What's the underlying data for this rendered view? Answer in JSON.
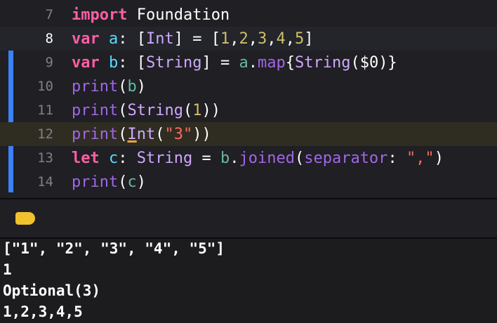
{
  "editor": {
    "lines": [
      {
        "num": "7"
      },
      {
        "num": "8"
      },
      {
        "num": "9"
      },
      {
        "num": "10"
      },
      {
        "num": "11"
      },
      {
        "num": "12"
      },
      {
        "num": "13"
      },
      {
        "num": "14"
      }
    ],
    "tokens": {
      "l7_import": "import",
      "l7_foundation": " Foundation",
      "l8_var": "var",
      "l8_a": "a",
      "l8_colon": ": [",
      "l8_int": "Int",
      "l8_eq": "] = [",
      "l8_n1": "1",
      "l8_n2": "2",
      "l8_n3": "3",
      "l8_n4": "4",
      "l8_n5": "5",
      "comma": ",",
      "l8_close": "]",
      "l9_var": "var",
      "l9_b": "b",
      "l9_colon": ": [",
      "l9_string": "String",
      "l9_eq": "] = ",
      "l9_a": "a",
      "l9_dot": ".",
      "l9_map": "map",
      "l9_brace": "{",
      "l9_string2": "String",
      "l9_arg": "($0)}",
      "l10_print": "print",
      "l10_open": "(",
      "l10_b": "b",
      "l10_close": ")",
      "l11_print": "print",
      "l11_open": "(",
      "l11_string": "String",
      "l11_open2": "(",
      "l11_n": "1",
      "l11_close": "))",
      "l12_print": "print",
      "l12_open": "(",
      "l12_I": "I",
      "l12_nt": "nt",
      "l12_open2": "(",
      "l12_str": "\"3\"",
      "l12_close": "))",
      "l13_let": "let",
      "l13_c": "c",
      "l13_colon": ": ",
      "l13_string": "String",
      "l13_eq": " = ",
      "l13_b": "b",
      "l13_dot": ".",
      "l13_joined": "joined",
      "l13_open": "(",
      "l13_sep": "separator",
      "l13_colon2": ": ",
      "l13_str": "\",\"",
      "l13_close": ")",
      "l14_print": "print",
      "l14_open": "(",
      "l14_c": "c",
      "l14_close": ")"
    }
  },
  "console": {
    "output": [
      "[\"1\", \"2\", \"3\", \"4\", \"5\"]",
      "1",
      "Optional(3)",
      "1,2,3,4,5"
    ]
  },
  "colors": {
    "background": "#1f1f24",
    "keyword": "#fc5fa3",
    "type": "#d0a8ff",
    "number": "#d0bf69",
    "string": "#fc6a5d",
    "change_bar": "#3b82f6",
    "debug_tag": "#f2c12e"
  },
  "icons": {
    "debug_tag": "breakpoint-tag-icon"
  }
}
